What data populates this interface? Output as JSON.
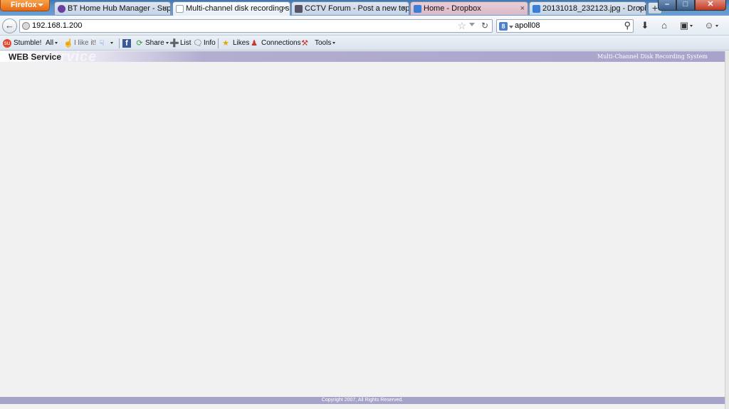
{
  "browser": {
    "menu_button": "Firefox",
    "tabs": [
      {
        "title": "BT Home Hub Manager - Supp...",
        "close": "×"
      },
      {
        "title": "Multi-channel disk recording s...",
        "close": "×"
      },
      {
        "title": "CCTV Forum - Post a new topic",
        "close": "×"
      },
      {
        "title": "Home - Dropbox",
        "close": "×"
      },
      {
        "title": "20131018_232123.jpg - Dropbox",
        "close": "×"
      }
    ],
    "new_tab": "+",
    "address": "192.168.1.200",
    "search_engine_letter": "8",
    "search_text": "apoll08"
  },
  "toolbar": {
    "stumble": "Stumble!",
    "all": "All",
    "like": "I like it!",
    "share": "Share",
    "list": "List",
    "info": "Info",
    "likes": "Likes",
    "connections": "Connections",
    "tools": "Tools"
  },
  "page": {
    "ghost_text": "WEB Service",
    "brand": "WEB Service",
    "system_title": "Multi-Channel Disk Recording System",
    "footer": "Copyright 2007,  All Rights Reserved."
  }
}
